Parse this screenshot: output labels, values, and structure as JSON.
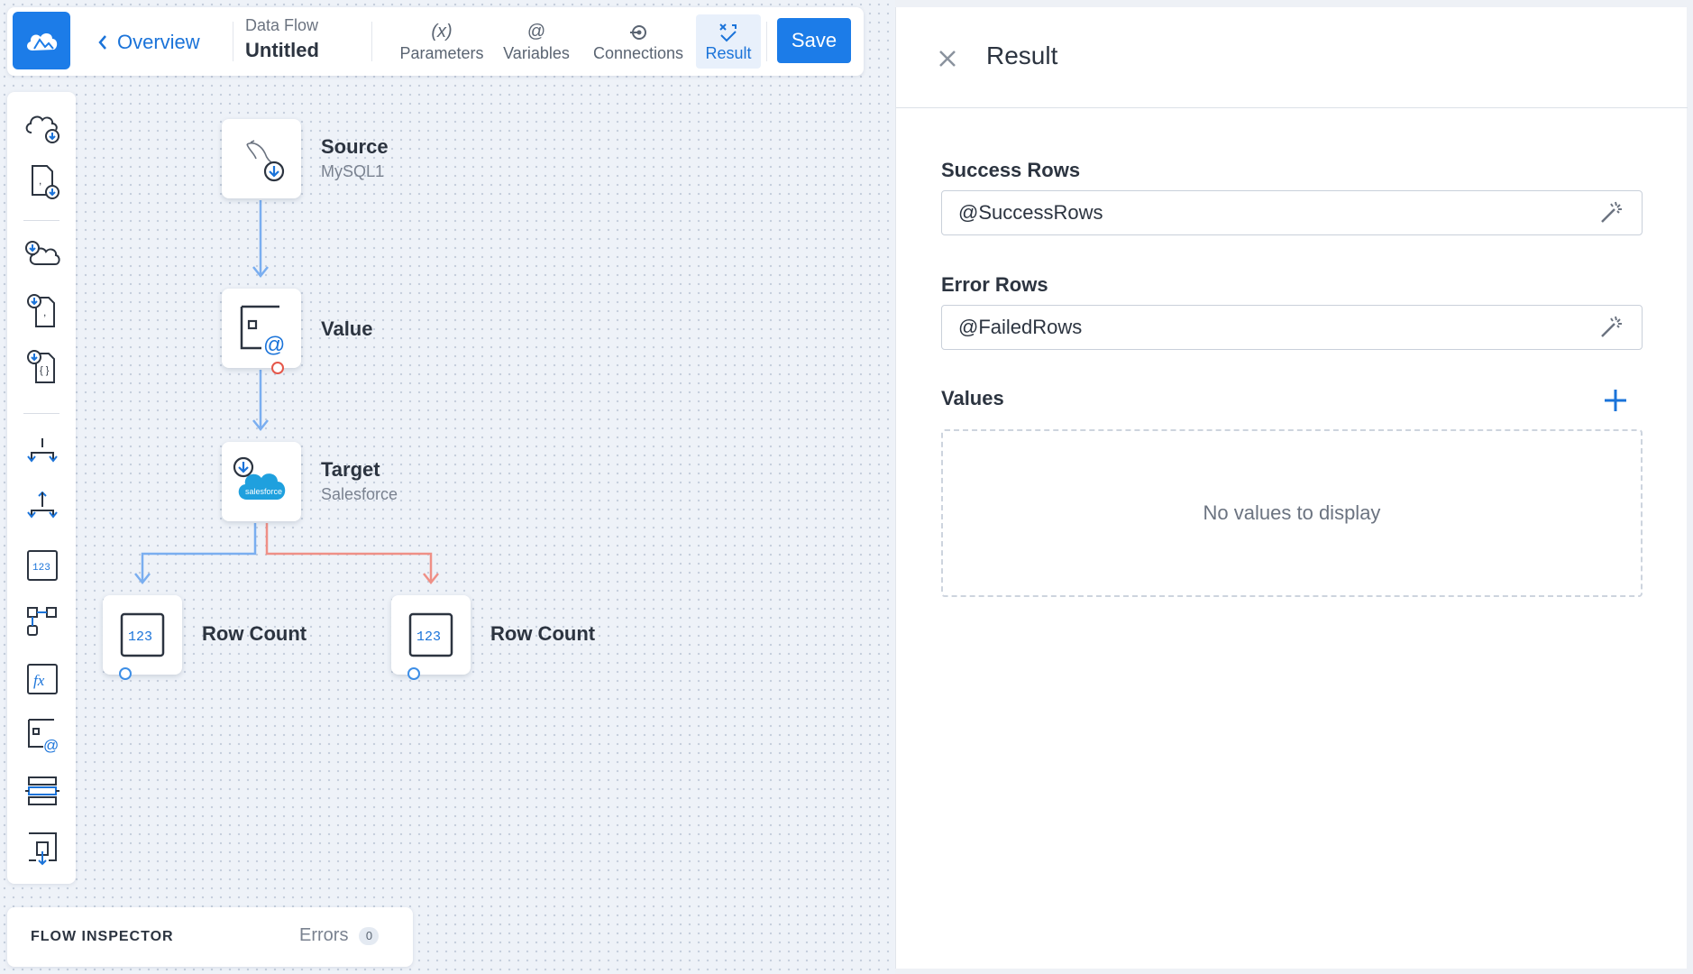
{
  "app": {
    "brand_color": "#1c7ce8",
    "logo_icon": "cloud-logo-icon"
  },
  "toolbar": {
    "back_label": "Overview",
    "doc_type": "Data Flow",
    "doc_name": "Untitled",
    "tools": [
      {
        "icon": "(x)",
        "label": "Parameters"
      },
      {
        "icon": "@",
        "label": "Variables"
      },
      {
        "icon": "connections-icon",
        "label": "Connections"
      },
      {
        "icon": "result-icon",
        "label": "Result",
        "active": true
      }
    ],
    "save_label": "Save"
  },
  "palette": {
    "items": [
      "cloud-source-icon",
      "file-source-icon",
      "cloud-target-icon",
      "file-target-icon",
      "json-target-icon",
      "split-icon",
      "merge-icon",
      "row-count-icon",
      "lookup-icon",
      "expression-icon",
      "value-icon",
      "buffer-icon",
      "file-export-icon"
    ]
  },
  "flow": {
    "nodes": [
      {
        "id": "source",
        "label": "Source",
        "sub": "MySQL1",
        "icon": "mysql-source-icon"
      },
      {
        "id": "value",
        "label": "Value",
        "sub": "",
        "icon": "value-icon"
      },
      {
        "id": "target",
        "label": "Target",
        "sub": "Salesforce",
        "icon": "salesforce-target-icon",
        "badge": "salesforce"
      },
      {
        "id": "rowcount1",
        "label": "Row Count",
        "sub": "",
        "icon": "row-count-icon"
      },
      {
        "id": "rowcount2",
        "label": "Row Count",
        "sub": "",
        "icon": "row-count-icon"
      }
    ],
    "success_color": "#7aaef0",
    "error_color": "#ef8f86"
  },
  "inspector": {
    "title": "FLOW INSPECTOR",
    "errors_label": "Errors",
    "errors_count": "0"
  },
  "panel": {
    "title": "Result",
    "success_rows": {
      "label": "Success Rows",
      "value": "@SuccessRows"
    },
    "error_rows": {
      "label": "Error Rows",
      "value": "@FailedRows"
    },
    "values": {
      "label": "Values",
      "empty_text": "No values to display"
    }
  }
}
